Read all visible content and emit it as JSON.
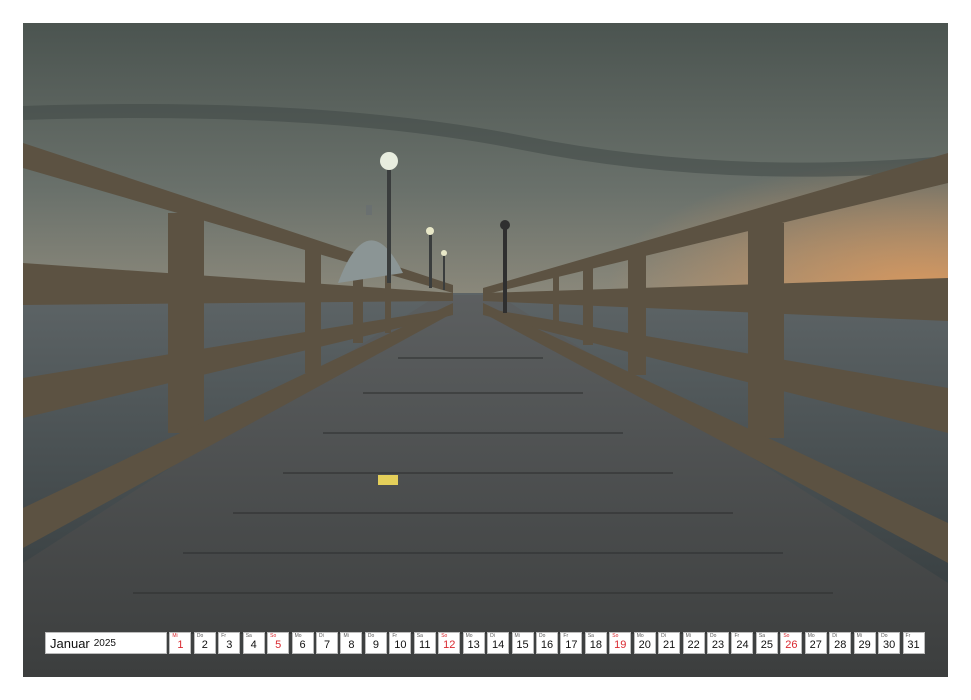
{
  "photo": {
    "subject": "pier-photo",
    "colors": {
      "sky_top": "#4d5650",
      "sky_horizon": "#d79a5e",
      "sea": "#3d4547",
      "deck": "#4a4c4b",
      "rail": "#5e5341"
    }
  },
  "calendar": {
    "month": "Januar",
    "year": "2025",
    "days": [
      {
        "wd": "Mi",
        "n": "1",
        "sun": true
      },
      {
        "wd": "Do",
        "n": "2",
        "sun": false
      },
      {
        "wd": "Fr",
        "n": "3",
        "sun": false
      },
      {
        "wd": "Sa",
        "n": "4",
        "sun": false
      },
      {
        "wd": "So",
        "n": "5",
        "sun": true
      },
      {
        "wd": "Mo",
        "n": "6",
        "sun": false
      },
      {
        "wd": "Di",
        "n": "7",
        "sun": false
      },
      {
        "wd": "Mi",
        "n": "8",
        "sun": false
      },
      {
        "wd": "Do",
        "n": "9",
        "sun": false
      },
      {
        "wd": "Fr",
        "n": "10",
        "sun": false
      },
      {
        "wd": "Sa",
        "n": "11",
        "sun": false
      },
      {
        "wd": "So",
        "n": "12",
        "sun": true
      },
      {
        "wd": "Mo",
        "n": "13",
        "sun": false
      },
      {
        "wd": "Di",
        "n": "14",
        "sun": false
      },
      {
        "wd": "Mi",
        "n": "15",
        "sun": false
      },
      {
        "wd": "Do",
        "n": "16",
        "sun": false
      },
      {
        "wd": "Fr",
        "n": "17",
        "sun": false
      },
      {
        "wd": "Sa",
        "n": "18",
        "sun": false
      },
      {
        "wd": "So",
        "n": "19",
        "sun": true
      },
      {
        "wd": "Mo",
        "n": "20",
        "sun": false
      },
      {
        "wd": "Di",
        "n": "21",
        "sun": false
      },
      {
        "wd": "Mi",
        "n": "22",
        "sun": false
      },
      {
        "wd": "Do",
        "n": "23",
        "sun": false
      },
      {
        "wd": "Fr",
        "n": "24",
        "sun": false
      },
      {
        "wd": "Sa",
        "n": "25",
        "sun": false
      },
      {
        "wd": "So",
        "n": "26",
        "sun": true
      },
      {
        "wd": "Mo",
        "n": "27",
        "sun": false
      },
      {
        "wd": "Di",
        "n": "28",
        "sun": false
      },
      {
        "wd": "Mi",
        "n": "29",
        "sun": false
      },
      {
        "wd": "Do",
        "n": "30",
        "sun": false
      },
      {
        "wd": "Fr",
        "n": "31",
        "sun": false
      }
    ]
  }
}
